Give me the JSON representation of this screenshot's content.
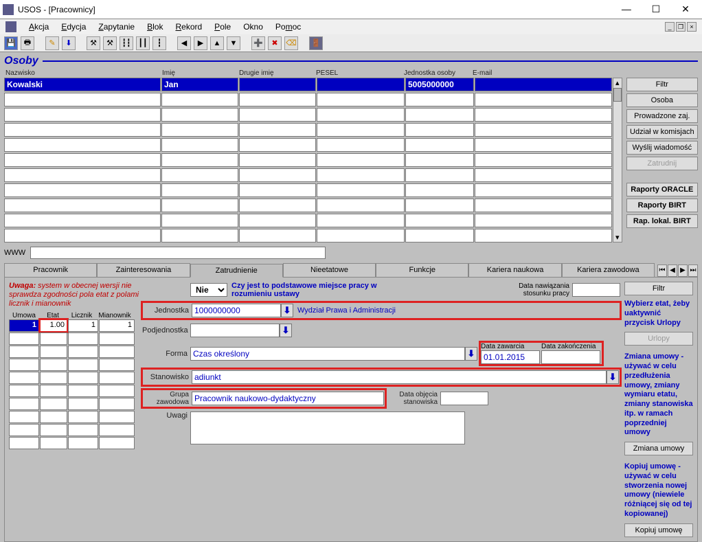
{
  "window": {
    "title": "USOS - [Pracownicy]"
  },
  "menu": {
    "akcja": "Akcja",
    "edycja": "Edycja",
    "zapytanie": "Zapytanie",
    "blok": "Blok",
    "rekord": "Rekord",
    "pole": "Pole",
    "okno": "Okno",
    "pomoc": "Pomoc"
  },
  "section": {
    "title": "Osoby"
  },
  "gridHeaders": {
    "nazwisko": "Nazwisko",
    "imie": "Imię",
    "drugie": "Drugie imię",
    "pesel": "PESEL",
    "jednostka": "Jednostka osoby",
    "email": "E-mail"
  },
  "person": {
    "nazwisko": "Kowalski",
    "imie": "Jan",
    "drugie": "",
    "pesel": "",
    "jednostka": "5005000000",
    "email": ""
  },
  "sideButtons": {
    "filtr": "Filtr",
    "osoba": "Osoba",
    "prowadzone": "Prowadzone zaj.",
    "udzial": "Udział w komisjach",
    "wyslij": "Wyślij wiadomość",
    "zatrudnij": "Zatrudnij",
    "raportyOracle": "Raporty ORACLE",
    "raportyBirt": "Raporty BIRT",
    "rapLokal": "Rap. lokal. BIRT"
  },
  "www": {
    "label": "WWW",
    "value": ""
  },
  "tabs": {
    "pracownik": "Pracownik",
    "zaint": "Zainteresowania",
    "zatr": "Zatrudnienie",
    "nieet": "Nieetatowe",
    "funk": "Funkcje",
    "karnauka": "Kariera naukowa",
    "karzaw": "Kariera zawodowa"
  },
  "warning": "Uwaga: system w obecnej wersji nie sprawdza zgodności pola etat z polami licznik i mianownik",
  "warningBold": "Uwaga:",
  "miniHeaders": {
    "umowa": "Umowa",
    "etat": "Etat",
    "licznik": "Licznik",
    "mian": "Mianownik"
  },
  "miniRow": {
    "umowa": "1",
    "etat": "1.00",
    "licznik": "1",
    "mian": "1"
  },
  "form": {
    "czyPodst": {
      "value": "Nie",
      "label": "Czy jest to podstawowe miejsce pracy w rozumieniu ustawy"
    },
    "dataNaw": {
      "label": "Data nawiązania stosunku pracy",
      "value": ""
    },
    "jednostka": {
      "label": "Jednostka",
      "value": "1000000000",
      "desc": "Wydział Prawa i Administracji"
    },
    "podjedn": {
      "label": "Podjednostka",
      "value": ""
    },
    "forma": {
      "label": "Forma",
      "value": "Czas określony"
    },
    "dataZaw": {
      "label": "Data zawarcia",
      "value": "01.01.2015"
    },
    "dataZak": {
      "label": "Data zakończenia",
      "value": ""
    },
    "stanowisko": {
      "label": "Stanowisko",
      "value": "adiunkt"
    },
    "grupa": {
      "label": "Grupa zawodowa",
      "value": "Pracownik naukowo-dydaktyczny"
    },
    "dataObj": {
      "label": "Data objęcia stanowiska",
      "value": ""
    },
    "uwagi": {
      "label": "Uwagi",
      "value": ""
    }
  },
  "rightPanel": {
    "filtr": "Filtr",
    "wybierz": "Wybierz etat, żeby uaktywnić przycisk Urlopy",
    "urlopy": "Urlopy",
    "zmianaInfo": "Zmiana umowy - używać w celu przedłużenia  umowy, zmiany wymiaru etatu, zmiany stanowiska itp. w ramach poprzedniej umowy",
    "zmiana": "Zmiana umowy",
    "kopiujInfo": "Kopiuj umowę - używać w celu stworzenia nowej umowy (niewiele różniącej się od tej kopiowanej)",
    "kopiuj": "Kopiuj umowę"
  }
}
